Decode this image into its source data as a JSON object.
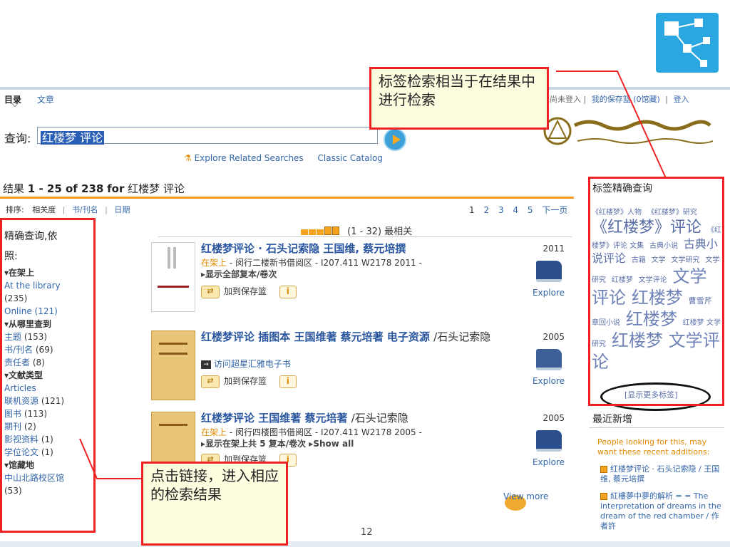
{
  "nav": {
    "active_tab": "目录",
    "tab2": "文章"
  },
  "user_links": {
    "status": "您尚未登入",
    "saved": "我的保存篮 (0馆藏)",
    "login": "登入",
    "sep": "|"
  },
  "search": {
    "label": "查询:",
    "value": "红楼梦 评论",
    "explore_related": "Explore Related Searches",
    "classic": "Classic Catalog"
  },
  "results_header": {
    "prefix": "结果",
    "range": "1 - 25 of 238",
    "for": "for",
    "query": "红楼梦 评论"
  },
  "sort": {
    "label": "排序:",
    "opt1": "相关度",
    "opt2": "书/刊名",
    "opt3": "日期",
    "sep": "|"
  },
  "pager": {
    "p1": "1",
    "p2": "2",
    "p3": "3",
    "p4": "4",
    "p5": "5",
    "next": "下一页"
  },
  "relevance": "(1 - 32) 最相关",
  "facets": {
    "heading": "精确查询,依",
    "heading2": "照:",
    "sec1": "▾在架上",
    "at_library": "At the library",
    "at_library_count": "(235)",
    "online": "Online (121)",
    "sec2": "▾从哪里查到",
    "subject": "主题",
    "subject_count": "(153)",
    "title": "书/刊名",
    "title_count": "(69)",
    "author": "责任者",
    "author_count": "(8)",
    "sec3": "▾文献类型",
    "articles": "Articles",
    "electronic": "联机资源",
    "electronic_count": "(121)",
    "books": "图书",
    "books_count": "(113)",
    "journals": "期刊",
    "journals_count": "(2)",
    "av": "影视资料",
    "av_count": "(1)",
    "thesis": "学位论文",
    "thesis_count": "(1)",
    "sec4": "▾馆藏地",
    "campus": "中山北路校区馆",
    "campus_count": "(53)"
  },
  "results": [
    {
      "title": "红楼梦评论 · 石头记索隐 王国维, 蔡元培撰",
      "year": "2011",
      "avail": "在架上",
      "loc": "- 闵行二楼新书借阅区 - I207.411 W2178 2011 -",
      "more": "▸显示全部复本/卷次",
      "save": "加到保存篮",
      "explore": "Explore",
      "info": "i"
    },
    {
      "title": "红楼梦评论 插图本 王国维著 蔡元培著 电子资源",
      "tail": "/石头记索隐",
      "year": "2005",
      "access": "访问超星汇雅电子书",
      "save": "加到保存篮",
      "explore": "Explore",
      "info": "i"
    },
    {
      "title": "红楼梦评论 王国维著 蔡元培著",
      "tail": "/石头记索隐",
      "year": "2005",
      "avail": "在架上",
      "loc": "- 闵行四楼图书借阅区 - I207.411 W2178 2005 -",
      "more": "▸显示在架上共 5 复本/卷次 ▸Show all",
      "save": "加到保存篮",
      "explore": "Explore",
      "info": "i"
    }
  ],
  "tag_cloud": {
    "title": "标签精确查询",
    "tags": [
      {
        "t": "《红楼梦》人物",
        "s": "t1"
      },
      {
        "t": "《红楼梦》研究",
        "s": "t1"
      },
      {
        "t": "《红楼梦》评论",
        "s": "t4"
      },
      {
        "t": "《红楼梦》评论 文集",
        "s": "t1"
      },
      {
        "t": "古典小说",
        "s": "t1"
      },
      {
        "t": "古典小说评论",
        "s": "t3"
      },
      {
        "t": "古籍",
        "s": "t1"
      },
      {
        "t": "文学",
        "s": "t1"
      },
      {
        "t": "文学研究",
        "s": "t1"
      },
      {
        "t": "文学研究",
        "s": "t1"
      },
      {
        "t": "红楼梦",
        "s": "t1"
      },
      {
        "t": "文学评论",
        "s": "t1"
      },
      {
        "t": "文学评论",
        "s": "t5"
      },
      {
        "t": "红楼梦",
        "s": "t5"
      },
      {
        "t": "曹雪芹",
        "s": "t2"
      },
      {
        "t": "章回小说",
        "s": "t1"
      },
      {
        "t": "红楼梦",
        "s": "t5"
      },
      {
        "t": "红楼梦 文学研究",
        "s": "t1"
      },
      {
        "t": "红楼梦",
        "s": "t5"
      },
      {
        "t": "文学评论",
        "s": "t5"
      }
    ],
    "more": "[显示更多标签]"
  },
  "recent": {
    "title": "最近新增",
    "note": "People looking for this, may want these recent additions:",
    "item1": "红楼梦评论 · 石头记索隐 / 王国维, 蔡元培撰",
    "item2": "紅樓夢中夢的解析 = = The interpretation of dreams in the dream of the red chamber / 作者許"
  },
  "view_more": "View more",
  "page_number": "12",
  "callouts": {
    "tag_note": "标签检索相当于在结果中进行检索",
    "facet_note": "点击链接，进入相应的检索结果"
  },
  "colors": {
    "accent": "#f59b1c",
    "link": "#3366aa",
    "annotation": "#e22222"
  }
}
